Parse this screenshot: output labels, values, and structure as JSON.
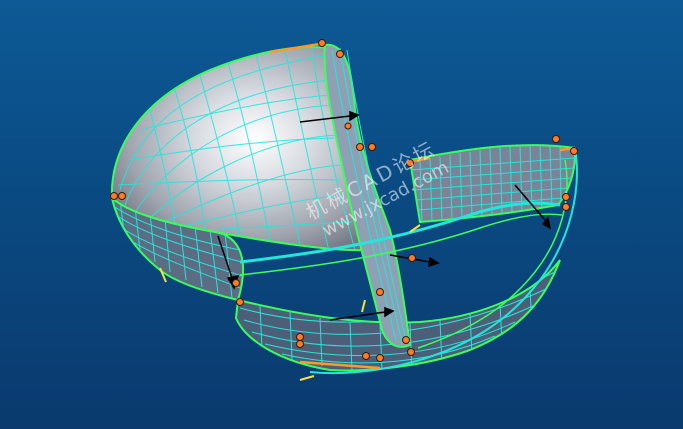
{
  "viewport": {
    "background_top": "#0d5a96",
    "background_bottom": "#0a3a6e"
  },
  "model": {
    "surface_color": "#c8ccd4",
    "wireframe_color": "#22e6dc",
    "edge_color": "#38ff5a",
    "highlight_edge_color": "#ff9a2a",
    "control_point_color": "#ff7a2a",
    "direction_arrow_color": "#000000"
  },
  "watermark": {
    "line1": "机械CAD论坛",
    "line2": "www.jxcad.com"
  }
}
